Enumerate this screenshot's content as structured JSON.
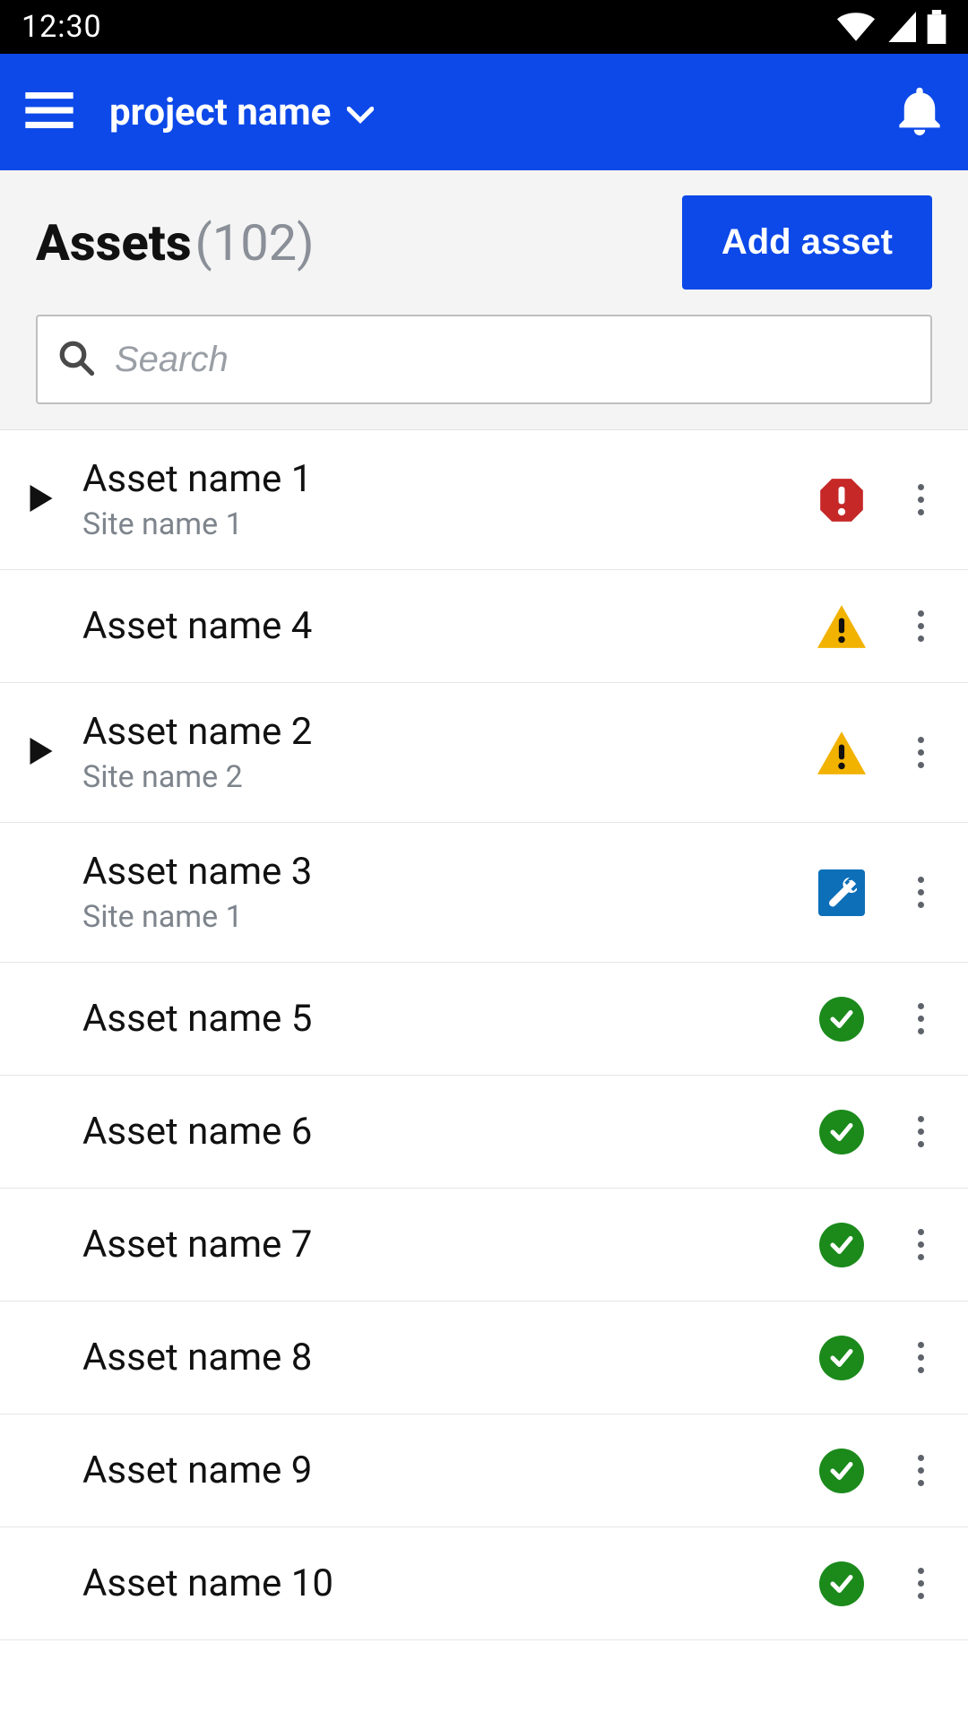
{
  "status_bar": {
    "time": "12:30"
  },
  "header": {
    "project_label": "project name"
  },
  "page": {
    "title": "Assets",
    "count_display": "(102)",
    "add_button_label": "Add asset",
    "search_placeholder": "Search"
  },
  "assets": [
    {
      "name": "Asset name 1",
      "site": "Site name 1",
      "expandable": true,
      "status": "error"
    },
    {
      "name": "Asset name 4",
      "site": "",
      "expandable": false,
      "status": "warning"
    },
    {
      "name": "Asset name 2",
      "site": "Site name 2",
      "expandable": true,
      "status": "warning"
    },
    {
      "name": "Asset name 3",
      "site": "Site name 1",
      "expandable": false,
      "status": "service"
    },
    {
      "name": "Asset name 5",
      "site": "",
      "expandable": false,
      "status": "ok"
    },
    {
      "name": "Asset name 6",
      "site": "",
      "expandable": false,
      "status": "ok"
    },
    {
      "name": "Asset name 7",
      "site": "",
      "expandable": false,
      "status": "ok"
    },
    {
      "name": "Asset name 8",
      "site": "",
      "expandable": false,
      "status": "ok"
    },
    {
      "name": "Asset name 9",
      "site": "",
      "expandable": false,
      "status": "ok"
    },
    {
      "name": "Asset name 10",
      "site": "",
      "expandable": false,
      "status": "ok"
    }
  ]
}
